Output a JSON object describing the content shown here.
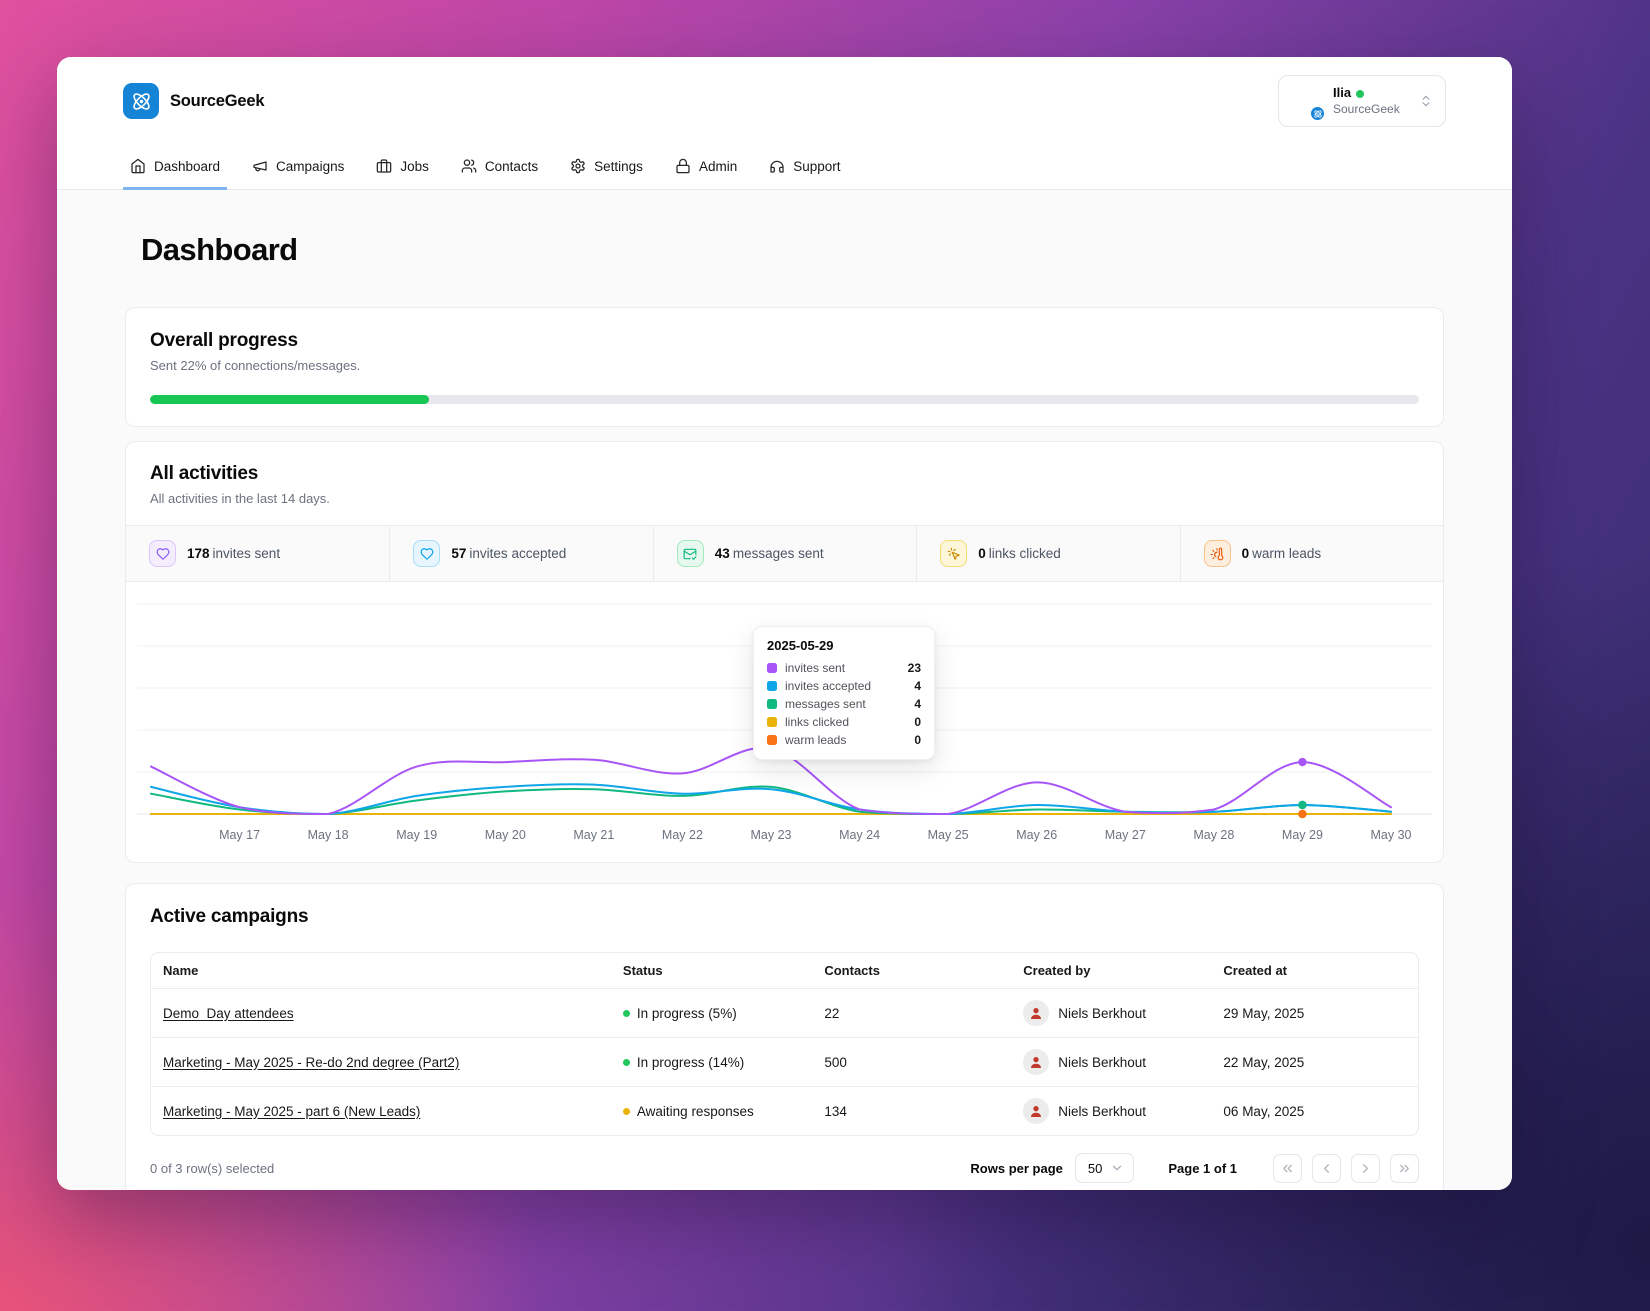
{
  "brand": {
    "name": "SourceGeek",
    "logo_color": "#1583d6"
  },
  "nav": {
    "items": [
      {
        "label": "Dashboard",
        "icon": "home-icon",
        "active": true
      },
      {
        "label": "Campaigns",
        "icon": "megaphone-icon",
        "active": false
      },
      {
        "label": "Jobs",
        "icon": "briefcase-icon",
        "active": false
      },
      {
        "label": "Contacts",
        "icon": "users-icon",
        "active": false
      },
      {
        "label": "Settings",
        "icon": "gear-icon",
        "active": false
      },
      {
        "label": "Admin",
        "icon": "lock-icon",
        "active": false
      },
      {
        "label": "Support",
        "icon": "headphones-icon",
        "active": false
      }
    ]
  },
  "user": {
    "name": "Ilia",
    "org": "SourceGeek",
    "online_color": "#22c55e"
  },
  "page": {
    "title": "Dashboard"
  },
  "overall_progress": {
    "title": "Overall progress",
    "subtitle": "Sent 22% of connections/messages.",
    "percent": 22,
    "bar_color": "#17c653"
  },
  "activities": {
    "title": "All activities",
    "subtitle": "All activities in the last 14 days.",
    "stats": [
      {
        "value": "178",
        "label": "invites sent",
        "icon": "heart-icon",
        "fg": "#8b5cf6",
        "bg": "#f4edfe",
        "border": "#dcc6fb"
      },
      {
        "value": "57",
        "label": "invites accepted",
        "icon": "heart-icon",
        "fg": "#0ea5e9",
        "bg": "#e6f5fe",
        "border": "#a8dcf8"
      },
      {
        "value": "43",
        "label": "messages sent",
        "icon": "mail-check-icon",
        "fg": "#10b981",
        "bg": "#e7f9ef",
        "border": "#a1e8bd"
      },
      {
        "value": "0",
        "label": "links clicked",
        "icon": "pointer-click-icon",
        "fg": "#ca8a04",
        "bg": "#fdf6d9",
        "border": "#f2dc74"
      },
      {
        "value": "0",
        "label": "warm leads",
        "icon": "thermometer-icon",
        "fg": "#ea580c",
        "bg": "#fdeedd",
        "border": "#f6c18c"
      }
    ]
  },
  "chart_data": {
    "type": "line",
    "x_labels": [
      "",
      "May 17",
      "May 18",
      "May 19",
      "May 20",
      "May 21",
      "May 22",
      "May 23",
      "May 24",
      "May 25",
      "May 26",
      "May 27",
      "May 28",
      "May 29",
      "May 30"
    ],
    "ylim": [
      0,
      93
    ],
    "grid": true,
    "grid_lines": 6,
    "legend_position": "tooltip-only",
    "series": [
      {
        "name": "invites sent",
        "color": "#a855f7",
        "values": [
          21,
          3,
          0,
          21,
          23,
          24,
          18,
          29,
          2,
          0,
          14,
          1,
          2,
          23,
          3
        ]
      },
      {
        "name": "invites accepted",
        "color": "#0ea5e9",
        "values": [
          12,
          3,
          0,
          8,
          12,
          13,
          9,
          11,
          2,
          0,
          4,
          1,
          1,
          4,
          1
        ]
      },
      {
        "name": "messages sent",
        "color": "#10b981",
        "values": [
          9,
          2,
          0,
          6,
          10,
          11,
          8,
          12,
          1,
          0,
          2,
          1,
          1,
          4,
          1
        ]
      },
      {
        "name": "links clicked",
        "color": "#eab308",
        "values": [
          0,
          0,
          0,
          0,
          0,
          0,
          0,
          0,
          0,
          0,
          0,
          0,
          0,
          0,
          0
        ]
      },
      {
        "name": "warm leads",
        "color": "#f97316",
        "values": [
          0,
          0,
          0,
          0,
          0,
          0,
          0,
          0,
          0,
          0,
          0,
          0,
          0,
          0,
          0
        ]
      }
    ],
    "hover_index": 13,
    "tooltip": {
      "title": "2025-05-29",
      "rows": [
        {
          "label": "invites sent",
          "value": "23",
          "color": "#a855f7"
        },
        {
          "label": "invites accepted",
          "value": "4",
          "color": "#0ea5e9"
        },
        {
          "label": "messages sent",
          "value": "4",
          "color": "#10b981"
        },
        {
          "label": "links clicked",
          "value": "0",
          "color": "#eab308"
        },
        {
          "label": "warm leads",
          "value": "0",
          "color": "#f97316"
        }
      ]
    }
  },
  "campaigns": {
    "title": "Active campaigns",
    "columns": [
      "Name",
      "Status",
      "Contacts",
      "Created by",
      "Created at"
    ],
    "rows": [
      {
        "name": "Demo_Day attendees",
        "status": "In progress (5%)",
        "status_color": "#22c55e",
        "contacts": "22",
        "created_by": "Niels Berkhout",
        "created_at": "29 May, 2025"
      },
      {
        "name": "Marketing - May 2025 - Re-do 2nd degree (Part2)",
        "status": "In progress (14%)",
        "status_color": "#22c55e",
        "contacts": "500",
        "created_by": "Niels Berkhout",
        "created_at": "22 May, 2025"
      },
      {
        "name": "Marketing - May 2025 - part 6 (New Leads)",
        "status": "Awaiting responses",
        "status_color": "#eab308",
        "contacts": "134",
        "created_by": "Niels Berkhout",
        "created_at": "06 May, 2025"
      }
    ],
    "footer": {
      "selected_info": "0 of 3 row(s) selected",
      "rows_per_page_label": "Rows per page",
      "rows_per_page_value": "50",
      "page_info": "Page 1 of 1",
      "pager_icons": [
        "chevrons-left-icon",
        "chevron-left-icon",
        "chevron-right-icon",
        "chevrons-right-icon"
      ]
    }
  }
}
